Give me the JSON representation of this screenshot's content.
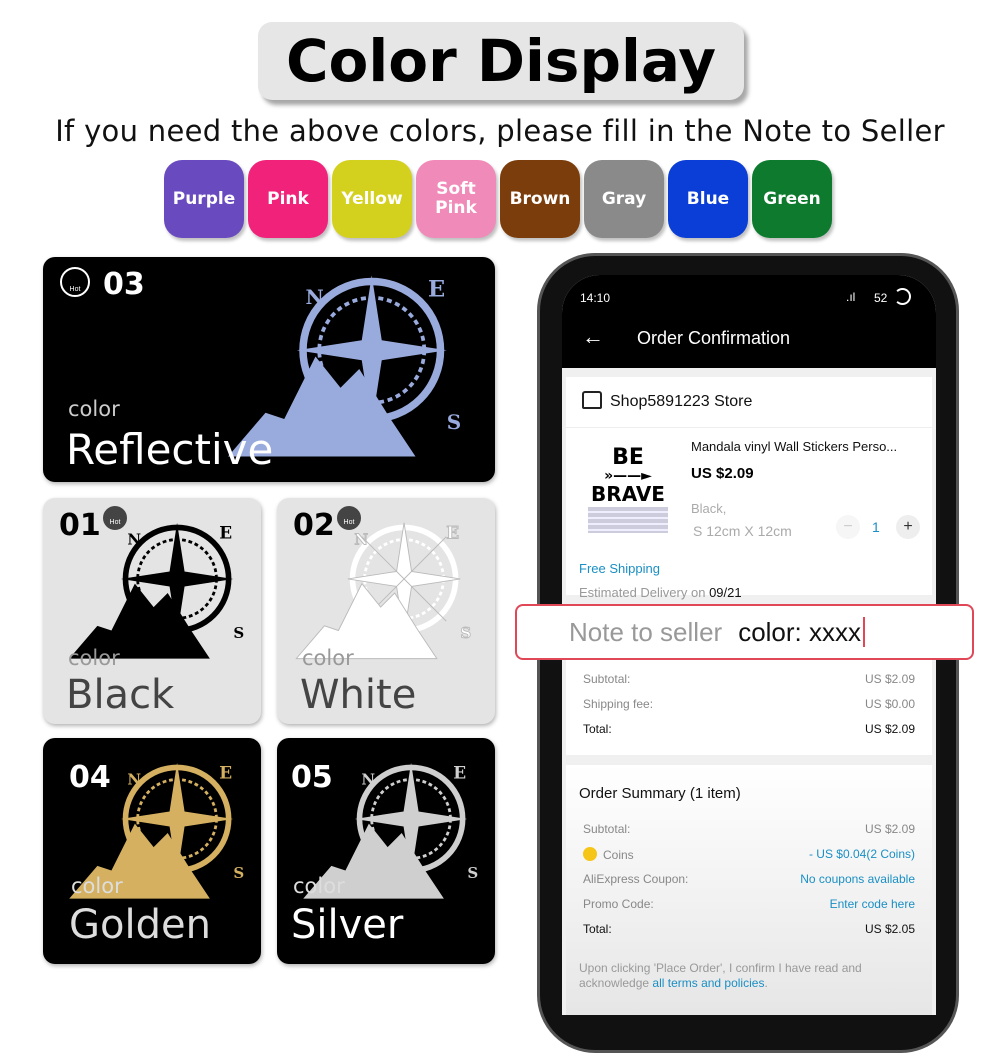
{
  "title": "Color Display",
  "subtitle": "If you need the above colors, please fill in the Note to Seller",
  "swatches": [
    {
      "label": "Purple",
      "color": "#6a4bbf"
    },
    {
      "label": "Pink",
      "color": "#f0227a"
    },
    {
      "label": "Yellow",
      "color": "#d4d01e"
    },
    {
      "label": "Soft Pink",
      "color": "#f08ab8"
    },
    {
      "label": "Brown",
      "color": "#7b3d0c"
    },
    {
      "label": "Gray",
      "color": "#8a8a8a"
    },
    {
      "label": "Blue",
      "color": "#0a3ed6"
    },
    {
      "label": "Green",
      "color": "#0d7a2e"
    }
  ],
  "cards": [
    {
      "num": "03",
      "color_label": "color",
      "name": "Reflective",
      "hot": "Hot"
    },
    {
      "num": "01",
      "color_label": "color",
      "name": "Black",
      "hot": "Hot"
    },
    {
      "num": "02",
      "color_label": "color",
      "name": "White",
      "hot": "Hot"
    },
    {
      "num": "04",
      "color_label": "color",
      "name": "Golden"
    },
    {
      "num": "05",
      "color_label": "color",
      "name": "Silver"
    }
  ],
  "phone": {
    "time": "14:10",
    "battery": "52",
    "header": "Order Confirmation",
    "store": "Shop5891223 Store",
    "product": {
      "title": "Mandala vinyl Wall Stickers Perso...",
      "price": "US $2.09",
      "variant1": "Black,",
      "variant2": "S 12cm X 12cm",
      "qty": "1",
      "thumb1": "BE",
      "thumb2": "BRAVE"
    },
    "free_shipping": "Free Shipping",
    "delivery_label": "Estimated Delivery on ",
    "delivery_date": "09/21",
    "totals": [
      {
        "k": "Subtotal:",
        "v": "US $2.09"
      },
      {
        "k": "Shipping fee:",
        "v": "US $0.00"
      },
      {
        "k": "Total:",
        "v": "US $2.09"
      }
    ],
    "summary_title": "Order Summary (1 item)",
    "summary": [
      {
        "k": "Subtotal:",
        "v": "US $2.09"
      },
      {
        "k": "Coins",
        "v": "- US $0.04(2 Coins)"
      },
      {
        "k": "AliExpress Coupon:",
        "v": "No coupons available"
      },
      {
        "k": "Promo Code:",
        "v": "Enter code here"
      },
      {
        "k": "Total:",
        "v": "US $2.05"
      }
    ],
    "footer": "Upon clicking 'Place Order', I confirm I have read and acknowledge ",
    "footer_link": "all terms and policies",
    "footer_end": "."
  },
  "note": {
    "label": "Note to seller",
    "value": "color: xxxx"
  },
  "accent": "#e04858"
}
